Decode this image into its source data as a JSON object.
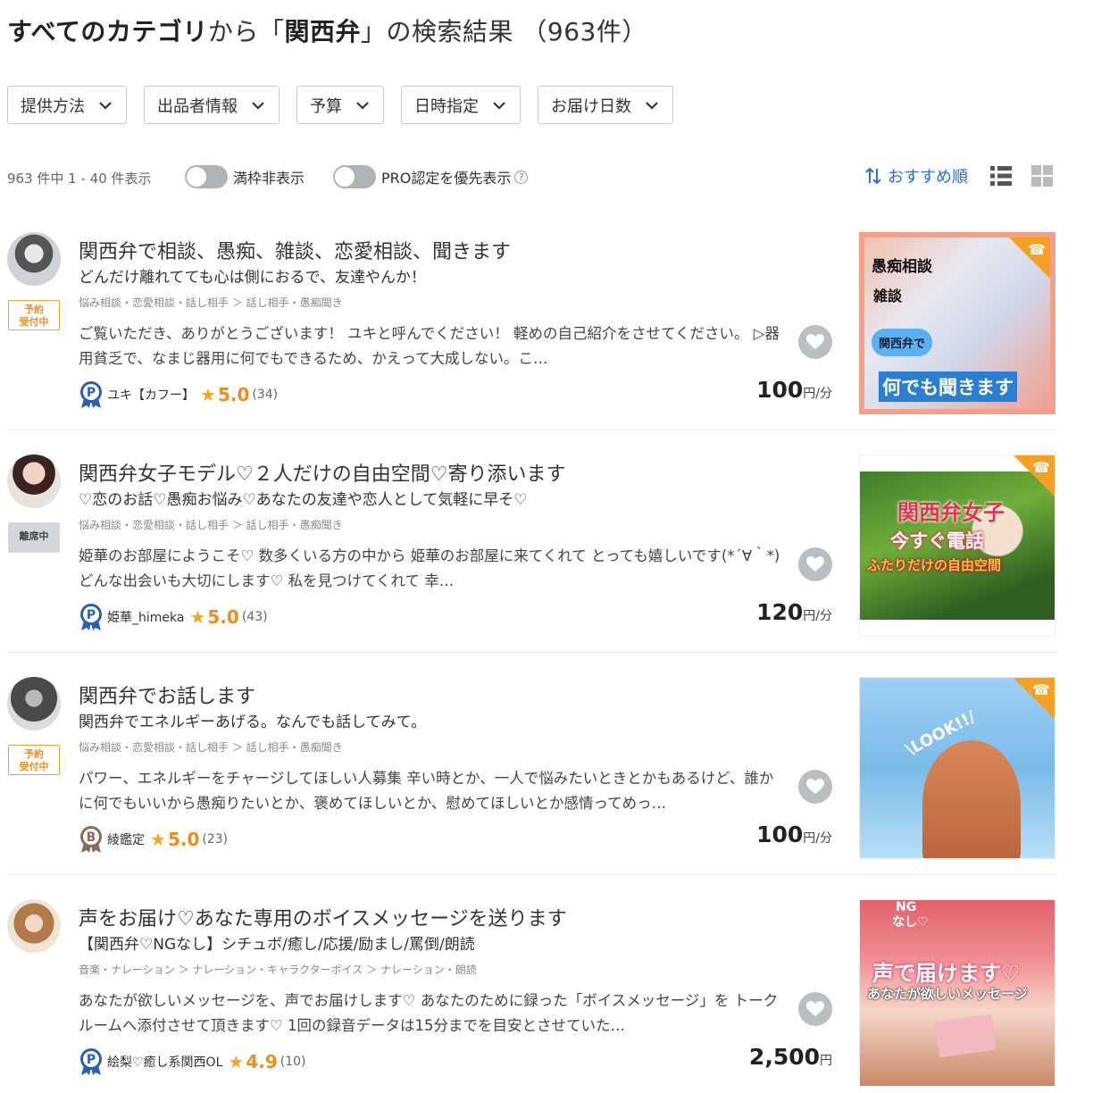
{
  "header": {
    "category": "すべてのカテゴリ",
    "from_text": "から「",
    "keyword": "関西弁",
    "suffix": "」の検索結果",
    "count_text": "（963件）"
  },
  "filters": [
    "提供方法",
    "出品者情報",
    "予算",
    "日時指定",
    "お届け日数"
  ],
  "toolbar": {
    "count_text": "963 件中 1 - 40 件表示",
    "toggle1_label": "満枠非表示",
    "toggle2_label": "PRO認定を優先表示",
    "help_symbol": "?",
    "sort_label": "おすすめ順"
  },
  "colors": {
    "accent": "#2a6fdb",
    "orange": "#f5a020",
    "star": "#f5a623",
    "heart": "#b9bec3"
  },
  "items": [
    {
      "title": "関西弁で相談、愚痴、雑談、恋愛相談、聞きます",
      "subtitle": "どんだけ離れてても心は側におるで、友達やんか！",
      "crumb": "悩み相談・恋愛相談・話し相手 ＞ 話し相手・愚痴聞き",
      "desc": "ご覧いただき、ありがとうございます！ ユキと呼んでください！ 軽めの自己紹介をさせてください。 ▷器用貧乏で、なまじ器用に何でもできるため、かえって大成しない。こ…",
      "badge": "予約\n受付中",
      "badge_type": "reserve",
      "medal": "P",
      "seller": "ユキ【カフー】",
      "star": "★",
      "rating": "5.0",
      "reviews": "(34)",
      "price": "100",
      "unit": "円/分",
      "thumb_lines": [
        "愚痴相談",
        "雑談",
        "関西弁で",
        "何でも聞きます"
      ]
    },
    {
      "title": "関西弁女子モデル♡２人だけの自由空間♡寄り添います",
      "subtitle": "♡恋のお話♡愚痴お悩み♡あなたの友達や恋人として気軽に早そ♡",
      "crumb": "悩み相談・恋愛相談・話し相手 ＞ 話し相手・愚痴聞き",
      "desc": "姫華のお部屋にようこそ♡ 数多くいる方の中から 姫華のお部屋に来てくれて とっても嬉しいです(*´∀｀*) どんな出会いも大切にします♡ 私を見つけてくれて 幸…",
      "badge": "離席中",
      "badge_type": "away",
      "medal": "P",
      "seller": "姫華_himeka",
      "star": "★",
      "rating": "5.0",
      "reviews": "(43)",
      "price": "120",
      "unit": "円/分",
      "thumb_lines": [
        "関西弁女子",
        "今すぐ電話",
        "ふたりだけの自由空間"
      ]
    },
    {
      "title": "関西弁でお話します",
      "subtitle": "関西弁でエネルギーあげる。なんでも話してみて。",
      "crumb": "悩み相談・恋愛相談・話し相手 ＞ 話し相手・愚痴聞き",
      "desc": "パワー、エネルギーをチャージしてほしい人募集 辛い時とか、一人で悩みたいときとかもあるけど、誰かに何でもいいから愚痴りたいとか、褒めてほしいとか、慰めてほしいとか感情ってめっ…",
      "badge": "予約\n受付中",
      "badge_type": "reserve",
      "medal": "B",
      "seller": "綾鑑定",
      "star": "★",
      "rating": "5.0",
      "reviews": "(23)",
      "price": "100",
      "unit": "円/分",
      "thumb_lines": [
        "\\LOOK!!/"
      ]
    },
    {
      "title": "声をお届け♡あなた専用のボイスメッセージを送ります",
      "subtitle": "【関西弁♡NGなし】シチュボ/癒し/応援/励まし/罵倒/朗読",
      "crumb": "音楽・ナレーション ＞ ナレーション・キャラクターボイス ＞ ナレーション・朗読",
      "desc": "あなたが欲しいメッセージを、声でお届けします♡ あなたのために録った「ボイスメッセージ」を トークルームへ添付させて頂きます♡ 1回の録音データは15分までを目安とさせていた…",
      "badge": "",
      "badge_type": "none",
      "medal": "P",
      "seller": "絵梨♡癒し系関西OL",
      "star": "★",
      "rating": "4.9",
      "reviews": "(10)",
      "price": "2,500",
      "unit": "円",
      "thumb_lines": [
        "NG",
        "なし♡",
        "声で届けます♡",
        "あなたが欲しいメッセージ"
      ]
    }
  ]
}
